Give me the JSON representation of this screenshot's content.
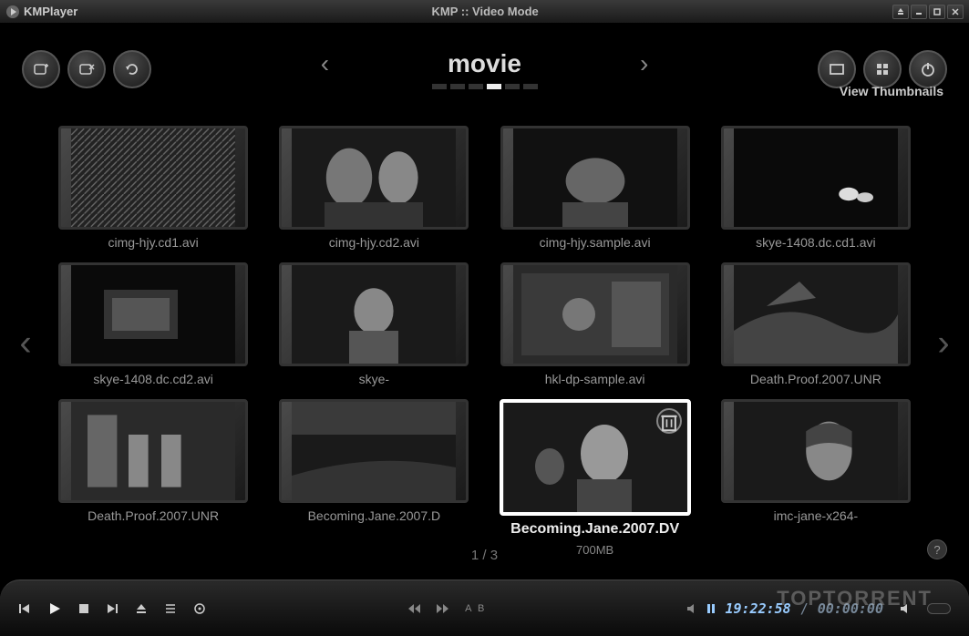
{
  "app_name": "KMPlayer",
  "window_title": "KMP :: Video Mode",
  "folder_title": "movie",
  "view_mode_label": "View Thumbnails",
  "page_indicator": "1 / 3",
  "thumbnails": [
    {
      "label": "cimg-hjy.cd1.avi"
    },
    {
      "label": "cimg-hjy.cd2.avi"
    },
    {
      "label": "cimg-hjy.sample.avi"
    },
    {
      "label": "skye-1408.dc.cd1.avi"
    },
    {
      "label": "skye-1408.dc.cd2.avi"
    },
    {
      "label": "skye-"
    },
    {
      "label": "hkl-dp-sample.avi"
    },
    {
      "label": "Death.Proof.2007.UNR"
    },
    {
      "label": "Death.Proof.2007.UNR"
    },
    {
      "label": "Becoming.Jane.2007.D"
    },
    {
      "label": "Becoming.Jane.2007.DV",
      "size": "700MB",
      "selected": true
    },
    {
      "label": "imc-jane-x264-"
    }
  ],
  "time": {
    "elapsed": "19:22:58",
    "total": "00:00:00"
  },
  "ab_label": "A     B",
  "watermark": "TOPTORRENT"
}
